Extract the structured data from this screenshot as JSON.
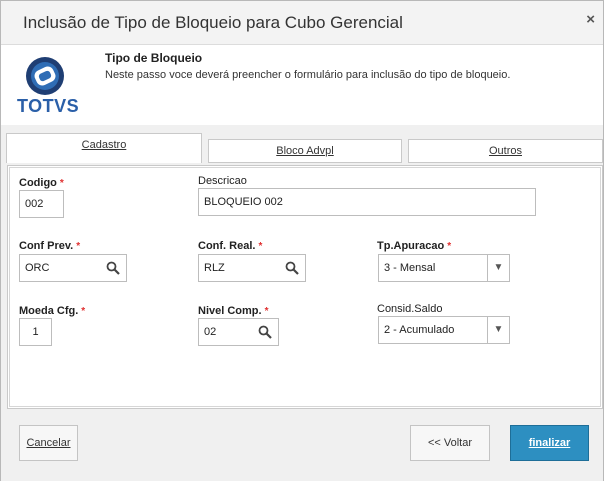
{
  "window": {
    "title": "Inclusão de Tipo de Bloqueio para Cubo Gerencial",
    "close_label": "×"
  },
  "header": {
    "logo_text": "TOTVS",
    "title": "Tipo de Bloqueio",
    "description": "Neste passo voce deverá preencher o formulário para inclusão do tipo de bloqueio."
  },
  "tabs": [
    {
      "label": "Cadastro",
      "active": true
    },
    {
      "label": "Bloco Advpl",
      "active": false
    },
    {
      "label": "Outros",
      "active": false
    }
  ],
  "form": {
    "codigo": {
      "label": "Codigo",
      "value": "002",
      "required": "*"
    },
    "descricao": {
      "label": "Descricao",
      "value": "BLOQUEIO 002"
    },
    "conf_prev": {
      "label": "Conf Prev.",
      "value": "ORC",
      "required": "*"
    },
    "conf_real": {
      "label": "Conf. Real.",
      "value": "RLZ",
      "required": "*"
    },
    "tp_apuracao": {
      "label": "Tp.Apuracao",
      "value": "3 - Mensal",
      "required": "*"
    },
    "moeda_cfg": {
      "label": "Moeda Cfg.",
      "value": "1",
      "required": "*"
    },
    "nivel_comp": {
      "label": "Nivel Comp.",
      "value": "02",
      "required": "*"
    },
    "consid_saldo": {
      "label": "Consid.Saldo",
      "value": "2 - Acumulado"
    }
  },
  "footer": {
    "cancel_label": "Cancelar",
    "back_label": "<< Voltar",
    "finish_label": "finalizar"
  },
  "colors": {
    "accent": "#2d8fc1",
    "required": "#e03030",
    "logo_blue": "#2a5fa8"
  },
  "icons": {
    "search": "search-icon",
    "dropdown": "chevron-down-icon",
    "close": "close-icon"
  }
}
